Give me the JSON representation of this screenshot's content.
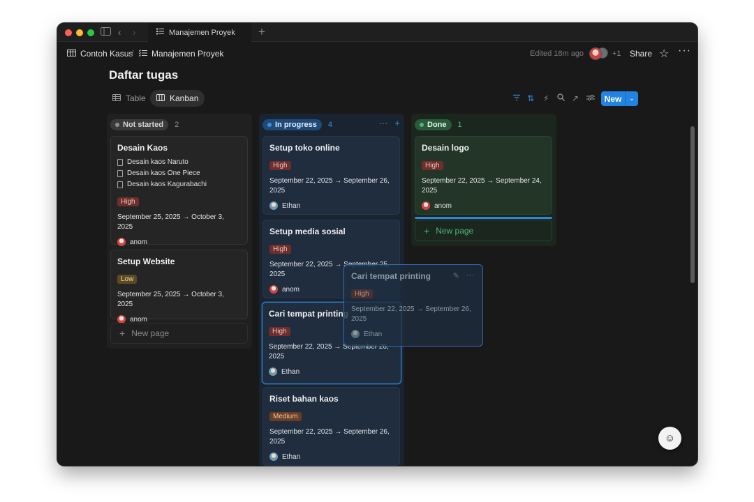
{
  "window": {
    "tab_title": "Manajemen Proyek"
  },
  "header": {
    "breadcrumb_root": "Contoh Kasus",
    "breadcrumb_sep": "/",
    "breadcrumb_page": "Manajemen Proyek",
    "edited": "Edited 18m ago",
    "extra_users": "+1",
    "share": "Share"
  },
  "page": {
    "title": "Daftar tugas"
  },
  "views": {
    "table": "Table",
    "kanban": "Kanban",
    "new": "New"
  },
  "colors": {
    "accent": "#2383e2",
    "high": "#6e2f2c",
    "low": "#5c4a24",
    "medium": "#6b3d24"
  },
  "columns": [
    {
      "status": "Not started",
      "count": "2",
      "cards": [
        {
          "title": "Desain Kaos",
          "subpages": [
            "Desain kaos Naruto",
            "Desain kaos One Piece",
            "Desain kaos Kagurabachi"
          ],
          "priority": "High",
          "dates": "September 25, 2025 → October 3, 2025",
          "assignee": "anom"
        },
        {
          "title": "Setup Website",
          "priority": "Low",
          "dates": "September 25, 2025 → October 3, 2025",
          "assignee": "anom"
        }
      ],
      "new_page": "New page"
    },
    {
      "status": "In progress",
      "count": "4",
      "cards": [
        {
          "title": "Setup toko online",
          "priority": "High",
          "dates": "September 22, 2025 → September 26, 2025",
          "assignee": "Ethan"
        },
        {
          "title": "Setup media sosial",
          "priority": "High",
          "dates": "September 22, 2025 → September 25, 2025",
          "assignee": "anom"
        },
        {
          "title": "Cari tempat printing",
          "priority": "High",
          "dates": "September 22, 2025 → September 26, 2025",
          "assignee": "Ethan"
        },
        {
          "title": "Riset bahan kaos",
          "priority": "Medium",
          "dates": "September 22, 2025 → September 26, 2025",
          "assignee": "Ethan"
        }
      ]
    },
    {
      "status": "Done",
      "count": "1",
      "cards": [
        {
          "title": "Desain logo",
          "priority": "High",
          "dates": "September 22, 2025 → September 24, 2025",
          "assignee": "anom"
        }
      ],
      "new_page": "New page"
    }
  ],
  "drag_ghost": {
    "title": "Cari tempat printing",
    "priority": "High",
    "dates": "September 22, 2025 → September 26, 2025",
    "assignee": "Ethan"
  }
}
